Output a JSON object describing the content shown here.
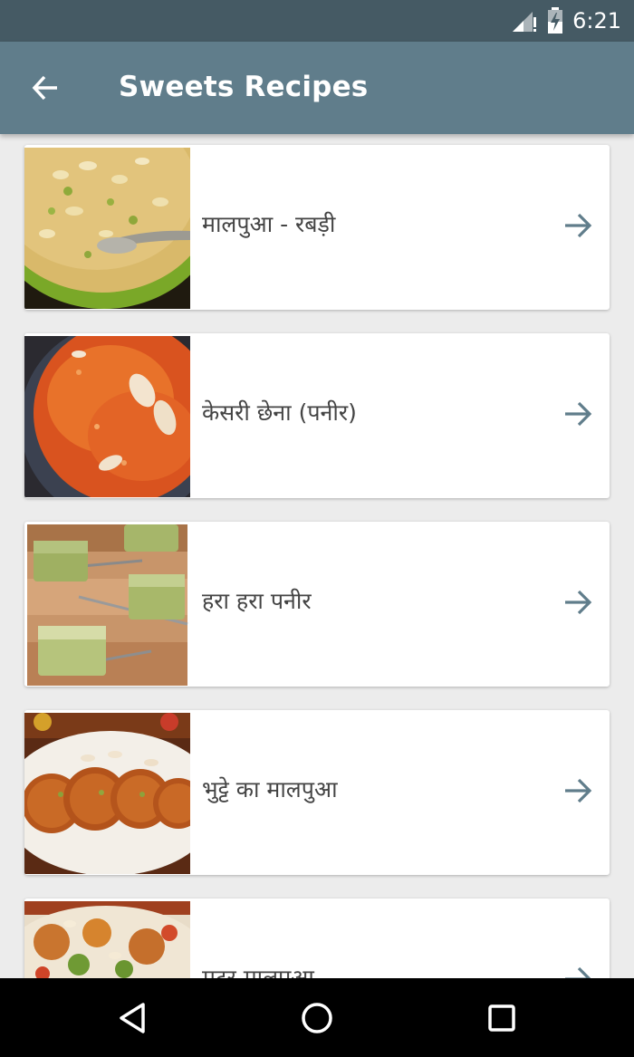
{
  "status_bar": {
    "time": "6:21",
    "icons": [
      "signal-no-data-icon",
      "battery-charging-icon"
    ]
  },
  "app_bar": {
    "title": "Sweets Recipes",
    "back_icon": "arrow-left-icon"
  },
  "recipes": [
    {
      "name": "मालपुआ - रबड़ी",
      "image": "rabri-bowl-photo",
      "action_icon": "arrow-right-icon"
    },
    {
      "name": "केसरी छेना (पनीर)",
      "image": "kesari-chhena-photo",
      "action_icon": "arrow-right-icon"
    },
    {
      "name": "हरा हरा पनीर",
      "image": "green-paneer-photo",
      "action_icon": "arrow-right-icon"
    },
    {
      "name": "भुट्टे का मालपुआ",
      "image": "corn-malpua-photo",
      "action_icon": "arrow-right-icon"
    },
    {
      "name": "मटर मालपुआ",
      "image": "matar-malpua-photo",
      "action_icon": "arrow-right-icon"
    }
  ],
  "nav_bar": {
    "buttons": [
      "back-triangle-icon",
      "home-circle-icon",
      "recents-square-icon"
    ]
  },
  "colors": {
    "status_bar": "#455a64",
    "app_bar": "#607d8b",
    "background": "#ececec",
    "arrow": "#607d8b"
  }
}
